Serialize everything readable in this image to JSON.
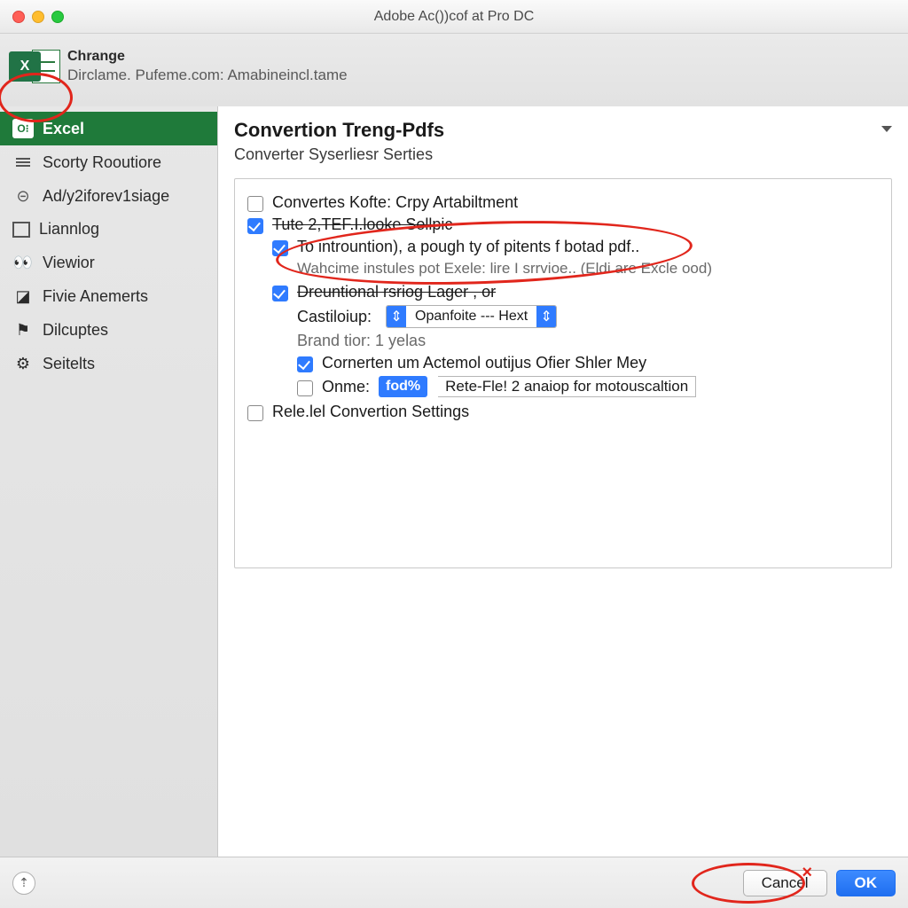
{
  "window": {
    "title": "Adobe Ac())cof at Pro DC"
  },
  "header": {
    "title": "Chrange",
    "sub": "Dirclame. Pufeme.com: Amabineincl.tame"
  },
  "sidebar": {
    "items": [
      {
        "label": "Excel",
        "active": true
      },
      {
        "label": "Scorty Rooutiore",
        "active": false
      },
      {
        "label": "Ad/y2iforev1siage",
        "active": false
      },
      {
        "label": "Liannlog",
        "active": false
      },
      {
        "label": "Viewior",
        "active": false
      },
      {
        "label": "Fivie Anemerts",
        "active": false
      },
      {
        "label": "Dilcuptes",
        "active": false
      },
      {
        "label": "Seitelts",
        "active": false
      }
    ]
  },
  "content": {
    "title": "Convertion Treng-Pdfs",
    "subtitle": "Converter Syserliesr Serties",
    "options": {
      "opt1": {
        "label": "Convertes Kofte: Crpy Artabiltment",
        "checked": false
      },
      "opt2": {
        "label": "Tute 2,TEF.I.looke Sollpic",
        "checked": true
      },
      "opt2a": {
        "label": "To intrountion), a pough ty of pitents f botad pdf..",
        "checked": true
      },
      "note1": "Wahcime instules pot Exele: lire I srrvioe.. (Eldi are Excle ood)",
      "opt2b": {
        "label": "Dreuntional rsriog Lager , or",
        "checked": true
      },
      "castlabel": "Castiloiup:",
      "castvalue": "Opanfoite --- Hext",
      "brand": "Brand tior: 1 yelas",
      "opt2c": {
        "label": "Cornerten um Actemol outijus Ofier Shler Mey",
        "checked": true
      },
      "opt2d": {
        "label": "Onme:",
        "checked": false
      },
      "badge": "fod%",
      "badge_after": "Rete-Fle! 2 anaiop for motouscaltion",
      "opt3": {
        "label": "Rele.lel Convertion Settings",
        "checked": false
      }
    }
  },
  "footer": {
    "cancel": "Cancel",
    "ok": "OK"
  },
  "annotations": {
    "color": "#e1261c"
  }
}
